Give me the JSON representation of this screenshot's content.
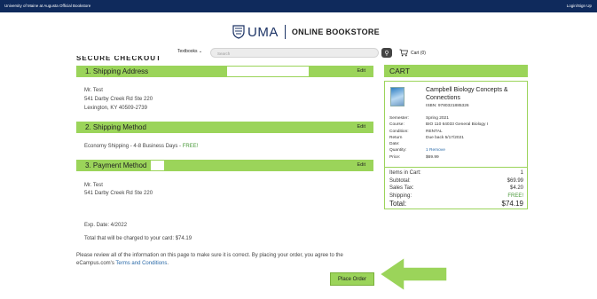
{
  "topbar": {
    "left_text": "University of Maine at Augusta Official Bookstore",
    "right_text": "Login/Sign Up"
  },
  "brand": {
    "name": "UMA",
    "subtitle": "ONLINE BOOKSTORE"
  },
  "nav": {
    "textbooks_label": "Textbooks",
    "search_placeholder": "Search",
    "cart_label": "Cart (0)"
  },
  "page": {
    "title": "SECURE CHECKOUT"
  },
  "shipping_address": {
    "header": "1. Shipping Address",
    "edit": "Edit",
    "lines": [
      "Mr. Test",
      "541 Darby Creek Rd Ste 220",
      "Lexington, KY 40509-2739"
    ]
  },
  "shipping_method": {
    "header": "2. Shipping Method",
    "edit": "Edit",
    "method": "Economy Shipping - 4-8 Business Days - ",
    "free": "FREE!"
  },
  "payment_method": {
    "header": "3. Payment Method",
    "edit": "Edit",
    "lines": [
      "Mr. Test",
      "541 Darby Creek Rd Ste 220"
    ],
    "exp_date": "Exp. Date: 4/2022",
    "total_charged": "Total that will be charged to your card: $74.19"
  },
  "review": {
    "line1": "Please review all of the information on this page to make sure it is correct. By placing your order, you agree to the",
    "line2_prefix": "eCampus.com's ",
    "terms_link": "Terms and Conditions",
    "line2_suffix": "."
  },
  "place_order_label": "Place Order",
  "cart": {
    "header": "CART",
    "product_title": "Campbell Biology Concepts & Connections",
    "isbn": "ISBN: 9780321885326",
    "details": [
      {
        "k": "Semester:",
        "v": "Spring 2021"
      },
      {
        "k": "Course:",
        "v": "BIO 110 64033 General Biology I"
      },
      {
        "k": "Condition:",
        "v": "RENTAL"
      },
      {
        "k": "Return",
        "v": "Due back 5/17/2021"
      },
      {
        "k": "Date:",
        "v": ""
      },
      {
        "k": "Quantity:",
        "v": "1"
      },
      {
        "k": "Price:",
        "v": "$69.99"
      }
    ],
    "remove_label": "Remove",
    "summary": [
      {
        "k": "Items in Cart:",
        "v": "1"
      },
      {
        "k": "Subtotal:",
        "v": "$69.99"
      },
      {
        "k": "Sales Tax:",
        "v": "$4.20"
      },
      {
        "k": "Shipping:",
        "v": "FREE!"
      }
    ],
    "total_label": "Total:",
    "total_value": "$74.19"
  },
  "colors": {
    "accent_green": "#9bd45a",
    "navy": "#0f2a5c",
    "free_green": "#4a9a3a",
    "link_blue": "#2a6aa8"
  }
}
